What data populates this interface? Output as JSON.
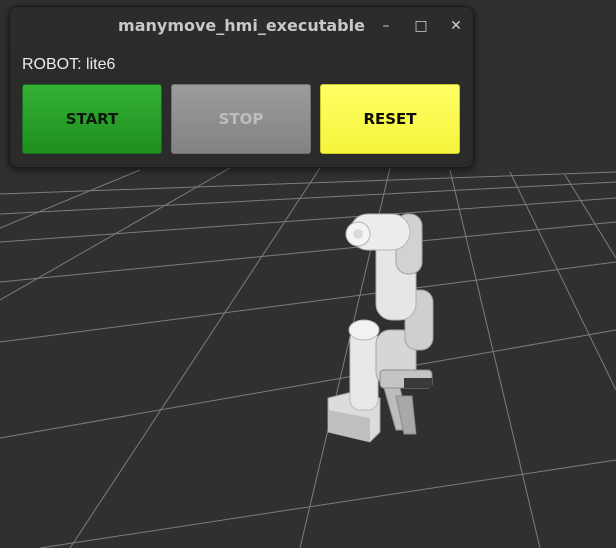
{
  "window": {
    "title": "manymove_hmi_executable",
    "minimize_glyph": "–",
    "maximize_glyph": "□",
    "close_glyph": "✕"
  },
  "robot": {
    "label": "ROBOT: lite6"
  },
  "buttons": {
    "start_label": "START",
    "stop_label": "STOP",
    "reset_label": "RESET",
    "stop_enabled": false
  },
  "colors": {
    "start": "#2aa82a",
    "stop": "#8e8e8e",
    "reset": "#ffff55",
    "viewport_background": "#303030",
    "grid_line": "#8a8a8a"
  },
  "viewport": {
    "grid": true,
    "model": "lite6 robot arm"
  }
}
